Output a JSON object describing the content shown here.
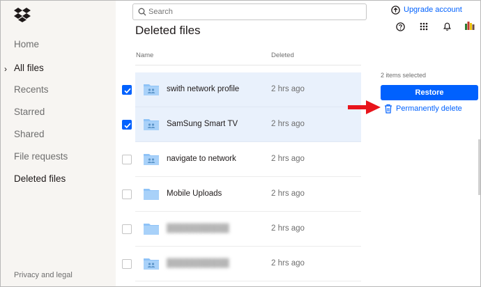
{
  "sidebar": {
    "items": [
      {
        "label": "Home"
      },
      {
        "label": "All files"
      },
      {
        "label": "Recents"
      },
      {
        "label": "Starred"
      },
      {
        "label": "Shared"
      },
      {
        "label": "File requests"
      },
      {
        "label": "Deleted files"
      }
    ],
    "privacy_label": "Privacy and legal"
  },
  "search": {
    "placeholder": "Search"
  },
  "page": {
    "title": "Deleted files"
  },
  "table": {
    "columns": [
      "Name",
      "Deleted"
    ],
    "rows": [
      {
        "name": "swith network profile",
        "deleted": "2 hrs ago",
        "checked": true,
        "shared": true
      },
      {
        "name": "SamSung Smart TV",
        "deleted": "2 hrs ago",
        "checked": true,
        "shared": true
      },
      {
        "name": "navigate to network",
        "deleted": "2 hrs ago",
        "checked": false,
        "shared": true
      },
      {
        "name": "Mobile Uploads",
        "deleted": "2 hrs ago",
        "checked": false,
        "shared": false
      },
      {
        "name": "",
        "deleted": "2 hrs ago",
        "checked": false,
        "shared": false
      },
      {
        "name": "",
        "deleted": "2 hrs ago",
        "checked": false,
        "shared": true
      }
    ]
  },
  "header": {
    "upgrade_label": "Upgrade account"
  },
  "panel": {
    "selected_count": "2 items selected",
    "restore_label": "Restore",
    "permanent_delete_label": "Permanently delete"
  },
  "colors": {
    "accent": "#0061fe",
    "sidebar_bg": "#f7f5f2",
    "selected_row": "#e9f1fc",
    "folder": "#8fc3f7",
    "annotation_arrow": "#e8141b"
  },
  "icons": {
    "logo": "dropbox-logo",
    "search": "search-icon",
    "upgrade": "upgrade-arrow-icon",
    "help": "help-icon",
    "apps": "apps-grid-icon",
    "notifications": "bell-icon",
    "delete": "trash-icon"
  }
}
